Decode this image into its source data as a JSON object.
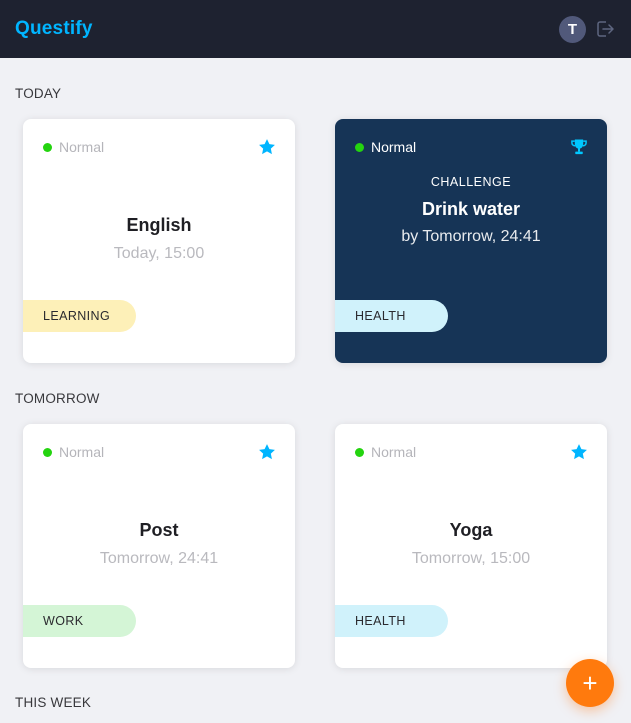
{
  "app": {
    "title": "Questify"
  },
  "user": {
    "initial": "T"
  },
  "colors": {
    "header_bg": "#1e2230",
    "brand": "#00b5ff",
    "challenge_bg": "#163456",
    "fab": "#ff7a0d",
    "status_dot": "#24d40f"
  },
  "sections": [
    {
      "label": "TODAY",
      "cards": [
        {
          "difficulty": "Normal",
          "icon": "star-icon",
          "challenge_label": "",
          "title": "English",
          "time": "Today, 15:00",
          "category": "LEARNING",
          "category_color": "#fdf0b8"
        },
        {
          "difficulty": "Normal",
          "icon": "trophy-icon",
          "challenge_label": "CHALLENGE",
          "title": "Drink water",
          "time": "by Tomorrow, 24:41",
          "category": "HEALTH",
          "category_color": "#d0f2fb"
        }
      ]
    },
    {
      "label": "TOMORROW",
      "cards": [
        {
          "difficulty": "Normal",
          "icon": "star-icon",
          "challenge_label": "",
          "title": "Post",
          "time": "Tomorrow, 24:41",
          "category": "WORK",
          "category_color": "#d4f5d6"
        },
        {
          "difficulty": "Normal",
          "icon": "star-icon",
          "challenge_label": "",
          "title": "Yoga",
          "time": "Tomorrow, 15:00",
          "category": "HEALTH",
          "category_color": "#d0f2fb"
        }
      ]
    },
    {
      "label": "THIS WEEK",
      "cards": []
    }
  ],
  "fab": {
    "label": "+"
  }
}
